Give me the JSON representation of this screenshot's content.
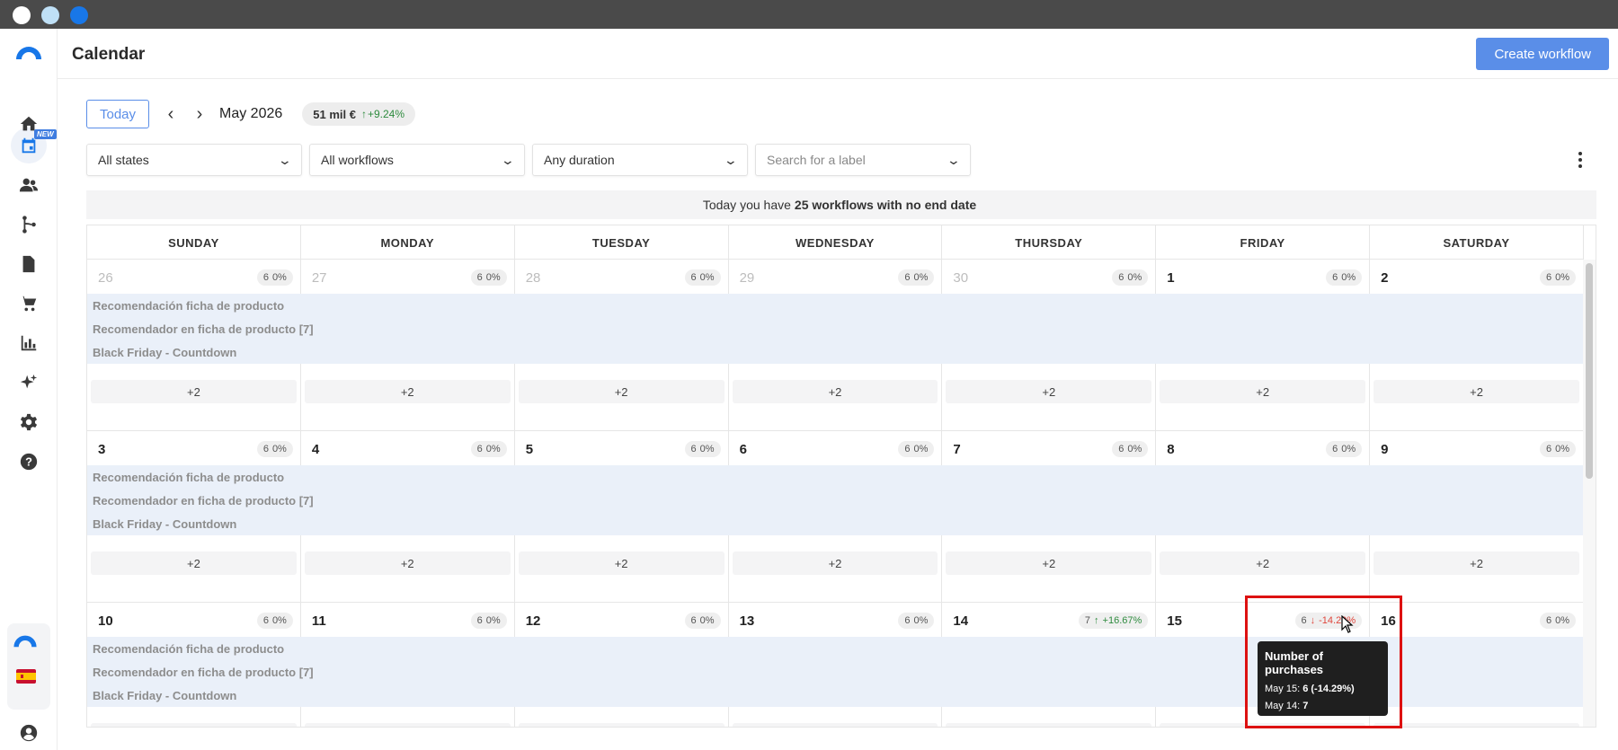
{
  "window": {
    "dot_colors": [
      "#ffffff",
      "#bfe0f6",
      "#1877e8"
    ]
  },
  "sidebar": {
    "icons": [
      "logo-icon",
      "home-icon",
      "calendar-icon",
      "users-icon",
      "workflow-icon",
      "document-icon",
      "cart-icon",
      "bar-chart-icon",
      "sparkles-icon",
      "gear-icon",
      "help-icon"
    ],
    "new_badge": "NEW",
    "bottom_icons": [
      "brand-logo-icon",
      "spain-flag-icon",
      "account-icon"
    ]
  },
  "header": {
    "title": "Calendar",
    "create_label": "Create workflow"
  },
  "toolbar": {
    "today_label": "Today",
    "month_label": "May 2026",
    "metric_value": "51 mil €",
    "metric_change": "+9.24%"
  },
  "filters": {
    "states": "All states",
    "workflows": "All workflows",
    "duration": "Any duration",
    "label_placeholder": "Search for a label"
  },
  "banner": {
    "prefix": "Today you have",
    "highlight": "25 workflows with no end date"
  },
  "calendar": {
    "day_headers": [
      "SUNDAY",
      "MONDAY",
      "TUESDAY",
      "WEDNESDAY",
      "THURSDAY",
      "FRIDAY",
      "SATURDAY"
    ],
    "more_label": "+2",
    "events": [
      "Recomendación ficha de producto",
      "Recomendador en ficha de producto [7]",
      "Black Friday - Countdown"
    ],
    "weeks": [
      [
        {
          "day": "26",
          "muted": true,
          "count": "6",
          "change": "0%",
          "trend": "none"
        },
        {
          "day": "27",
          "muted": true,
          "count": "6",
          "change": "0%",
          "trend": "none"
        },
        {
          "day": "28",
          "muted": true,
          "count": "6",
          "change": "0%",
          "trend": "none"
        },
        {
          "day": "29",
          "muted": true,
          "count": "6",
          "change": "0%",
          "trend": "none"
        },
        {
          "day": "30",
          "muted": true,
          "count": "6",
          "change": "0%",
          "trend": "none"
        },
        {
          "day": "1",
          "muted": false,
          "count": "6",
          "change": "0%",
          "trend": "none"
        },
        {
          "day": "2",
          "muted": false,
          "count": "6",
          "change": "0%",
          "trend": "none"
        }
      ],
      [
        {
          "day": "3",
          "muted": false,
          "count": "6",
          "change": "0%",
          "trend": "none"
        },
        {
          "day": "4",
          "muted": false,
          "count": "6",
          "change": "0%",
          "trend": "none"
        },
        {
          "day": "5",
          "muted": false,
          "count": "6",
          "change": "0%",
          "trend": "none"
        },
        {
          "day": "6",
          "muted": false,
          "count": "6",
          "change": "0%",
          "trend": "none"
        },
        {
          "day": "7",
          "muted": false,
          "count": "6",
          "change": "0%",
          "trend": "none"
        },
        {
          "day": "8",
          "muted": false,
          "count": "6",
          "change": "0%",
          "trend": "none"
        },
        {
          "day": "9",
          "muted": false,
          "count": "6",
          "change": "0%",
          "trend": "none"
        }
      ],
      [
        {
          "day": "10",
          "muted": false,
          "count": "6",
          "change": "0%",
          "trend": "none"
        },
        {
          "day": "11",
          "muted": false,
          "count": "6",
          "change": "0%",
          "trend": "none"
        },
        {
          "day": "12",
          "muted": false,
          "count": "6",
          "change": "0%",
          "trend": "none"
        },
        {
          "day": "13",
          "muted": false,
          "count": "6",
          "change": "0%",
          "trend": "none"
        },
        {
          "day": "14",
          "muted": false,
          "count": "7",
          "change": "+16.67%",
          "trend": "up"
        },
        {
          "day": "15",
          "muted": false,
          "count": "6",
          "change": "-14.29%",
          "trend": "down"
        },
        {
          "day": "16",
          "muted": false,
          "count": "6",
          "change": "0%",
          "trend": "none"
        }
      ]
    ]
  },
  "tooltip": {
    "title": "Number of purchases",
    "row1_label": "May 15:",
    "row1_value": "6 (-14.29%)",
    "row2_label": "May 14:",
    "row2_value": "7"
  }
}
